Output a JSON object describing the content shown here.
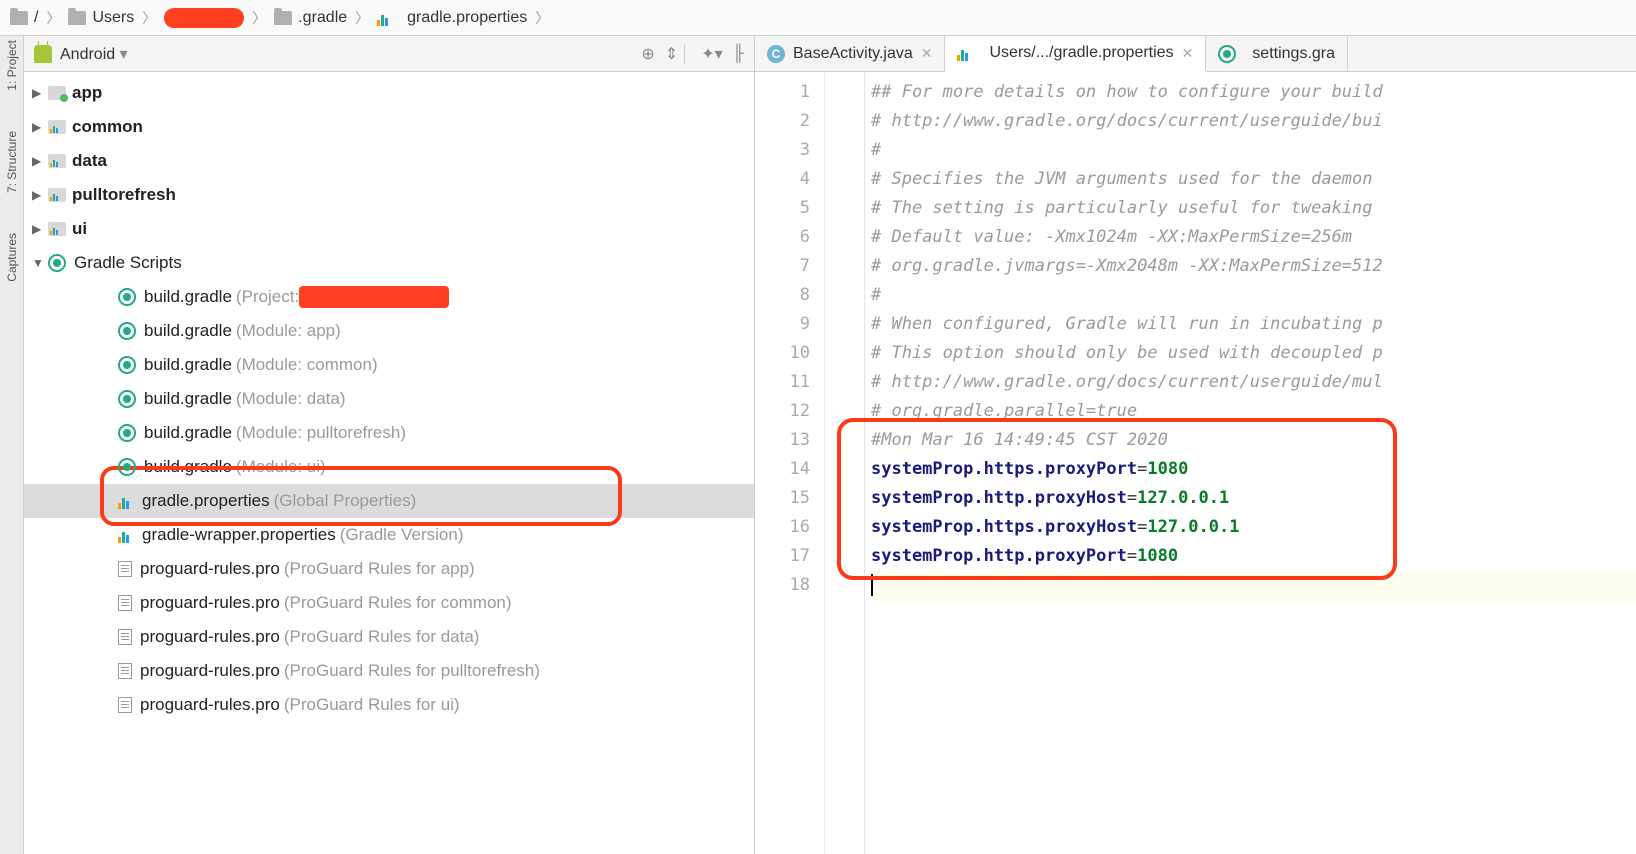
{
  "breadcrumb": [
    {
      "label": "/"
    },
    {
      "label": "Users"
    },
    {
      "label": "",
      "redacted": true
    },
    {
      "label": ".gradle"
    },
    {
      "label": "gradle.properties",
      "icon": "prop"
    }
  ],
  "sidetabs": [
    "1: Project",
    "7: Structure",
    "Captures"
  ],
  "panel": {
    "title": "Android",
    "icons": [
      "target",
      "collapse",
      "gear",
      "hide"
    ]
  },
  "tree": [
    {
      "d": 0,
      "arrow": "▶",
      "icon": "mod-green",
      "label": "app",
      "bold": true
    },
    {
      "d": 0,
      "arrow": "▶",
      "icon": "mod-bars",
      "label": "common",
      "bold": true
    },
    {
      "d": 0,
      "arrow": "▶",
      "icon": "mod-bars",
      "label": "data",
      "bold": true
    },
    {
      "d": 0,
      "arrow": "▶",
      "icon": "mod-bars",
      "label": "pulltorefresh",
      "bold": true
    },
    {
      "d": 0,
      "arrow": "▶",
      "icon": "mod-bars",
      "label": "ui",
      "bold": true
    },
    {
      "d": 0,
      "arrow": "▼",
      "icon": "gradle",
      "label": "Gradle Scripts"
    },
    {
      "d": 1,
      "icon": "gradle",
      "label": "build.gradle ",
      "desc": "(Project:",
      "redact": true,
      "descEnd": ""
    },
    {
      "d": 1,
      "icon": "gradle",
      "label": "build.gradle ",
      "desc": "(Module: app)"
    },
    {
      "d": 1,
      "icon": "gradle",
      "label": "build.gradle ",
      "desc": "(Module: common)"
    },
    {
      "d": 1,
      "icon": "gradle",
      "label": "build.gradle ",
      "desc": "(Module: data)"
    },
    {
      "d": 1,
      "icon": "gradle",
      "label": "build.gradle ",
      "desc": "(Module: pulltorefresh)"
    },
    {
      "d": 1,
      "icon": "gradle",
      "label": "build.gradle ",
      "desc": "(Module: ui)"
    },
    {
      "d": 1,
      "icon": "prop",
      "label": "gradle.properties ",
      "desc": "(Global Properties)",
      "sel": true
    },
    {
      "d": 1,
      "icon": "prop",
      "label": "gradle-wrapper.properties ",
      "desc": "(Gradle Version)"
    },
    {
      "d": 1,
      "icon": "file",
      "label": "proguard-rules.pro ",
      "desc": "(ProGuard Rules for app)"
    },
    {
      "d": 1,
      "icon": "file",
      "label": "proguard-rules.pro ",
      "desc": "(ProGuard Rules for common)"
    },
    {
      "d": 1,
      "icon": "file",
      "label": "proguard-rules.pro ",
      "desc": "(ProGuard Rules for data)"
    },
    {
      "d": 1,
      "icon": "file",
      "label": "proguard-rules.pro ",
      "desc": "(ProGuard Rules for pulltorefresh)"
    },
    {
      "d": 1,
      "icon": "file",
      "label": "proguard-rules.pro ",
      "desc": "(ProGuard Rules for ui)"
    }
  ],
  "tabs": [
    {
      "icon": "c",
      "label": "BaseActivity.java",
      "active": false
    },
    {
      "icon": "prop",
      "label": "Users/.../gradle.properties",
      "active": true
    },
    {
      "icon": "gradle",
      "label": "settings.gra",
      "active": false,
      "noclose": true
    }
  ],
  "code": [
    {
      "n": 1,
      "t": "comment",
      "s": "## For more details on how to configure your build "
    },
    {
      "n": 2,
      "t": "comment",
      "s": "# http://www.gradle.org/docs/current/userguide/bui"
    },
    {
      "n": 3,
      "t": "comment",
      "s": "#"
    },
    {
      "n": 4,
      "t": "comment",
      "s": "# Specifies the JVM arguments used for the daemon "
    },
    {
      "n": 5,
      "t": "comment",
      "s": "# The setting is particularly useful for tweaking "
    },
    {
      "n": 6,
      "t": "comment",
      "s": "# Default value: -Xmx1024m -XX:MaxPermSize=256m"
    },
    {
      "n": 7,
      "t": "comment",
      "s": "# org.gradle.jvmargs=-Xmx2048m -XX:MaxPermSize=512"
    },
    {
      "n": 8,
      "t": "comment",
      "s": "#"
    },
    {
      "n": 9,
      "t": "comment",
      "s": "# When configured, Gradle will run in incubating p"
    },
    {
      "n": 10,
      "t": "comment",
      "s": "# This option should only be used with decoupled p"
    },
    {
      "n": 11,
      "t": "comment",
      "s": "# http://www.gradle.org/docs/current/userguide/mul"
    },
    {
      "n": 12,
      "t": "comment",
      "s": "# org.gradle.parallel=true"
    },
    {
      "n": 13,
      "t": "comment",
      "s": "#Mon Mar 16 14:49:45 CST 2020"
    },
    {
      "n": 14,
      "t": "kv",
      "k": "systemProp.https.proxyPort",
      "v": "1080"
    },
    {
      "n": 15,
      "t": "kv",
      "k": "systemProp.http.proxyHost",
      "v": "127.0.0.1"
    },
    {
      "n": 16,
      "t": "kv",
      "k": "systemProp.https.proxyHost",
      "v": "127.0.0.1"
    },
    {
      "n": 17,
      "t": "kv",
      "k": "systemProp.http.proxyPort",
      "v": "1080"
    },
    {
      "n": 18,
      "t": "empty",
      "cur": true
    }
  ]
}
